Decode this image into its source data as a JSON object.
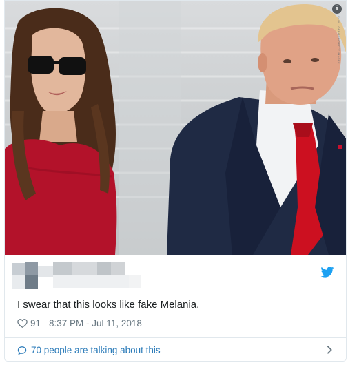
{
  "photo": {
    "info_badge": "i",
    "credit": "SAUL LOEB/AFP/GETTY IMAGES"
  },
  "tweet": {
    "text": "I swear that this looks like fake Melania.",
    "likes": "91",
    "timestamp": "8:37 PM - Jul 11, 2018",
    "talking": "70 people are talking about this"
  },
  "icons": {
    "info": "info-icon",
    "bird": "twitter-bird-icon",
    "heart": "heart-icon",
    "bubble": "speech-bubble-icon",
    "chevron": "chevron-right-icon"
  },
  "colors": {
    "link": "#2b7bb9",
    "twitter": "#1da1f2",
    "muted": "#697882",
    "border": "#e1e8ed"
  }
}
